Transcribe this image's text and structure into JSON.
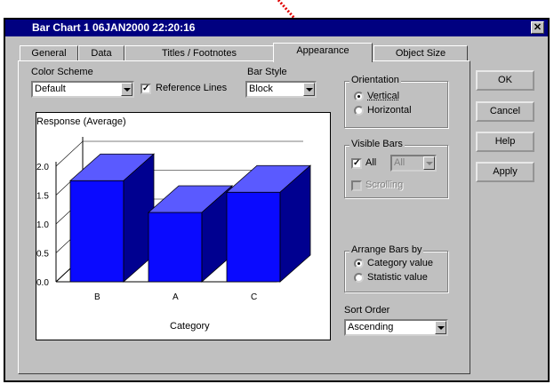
{
  "window": {
    "title": "Bar Chart 1 06JAN2000 22:20:16",
    "close_glyph": "✕"
  },
  "tabs": [
    "General",
    "Data",
    "Titles / Footnotes",
    "Appearance",
    "Object Size"
  ],
  "active_tab": "Appearance",
  "color_scheme": {
    "label": "Color Scheme",
    "value": "Default"
  },
  "reference_lines": {
    "label": "Reference Lines",
    "checked": true
  },
  "bar_style": {
    "label": "Bar Style",
    "value": "Block"
  },
  "orientation": {
    "title": "Orientation",
    "options": [
      "Vertical",
      "Horizontal"
    ],
    "selected": "Vertical"
  },
  "visible_bars": {
    "title": "Visible Bars",
    "all_label": "All",
    "all_checked": true,
    "combo_value": "All",
    "scrolling_label": "Scrolling"
  },
  "arrange_bars": {
    "title": "Arrange Bars by",
    "options": [
      "Category value",
      "Statistic value"
    ],
    "selected": "Category value"
  },
  "sort_order": {
    "label": "Sort Order",
    "value": "Ascending"
  },
  "buttons": {
    "ok": "OK",
    "cancel": "Cancel",
    "help": "Help",
    "apply": "Apply"
  },
  "colors": {
    "bar_front": "#0a0aff",
    "bar_top": "#5a5aff",
    "bar_side": "#000090",
    "title_bar": "#000080",
    "dialog": "#c0c0c0"
  },
  "chart_data": {
    "type": "bar",
    "title": "Response (Average)",
    "xlabel": "Category",
    "ylabel": "",
    "categories": [
      "B",
      "A",
      "C"
    ],
    "values": [
      1.75,
      1.2,
      1.55
    ],
    "ylim": [
      0,
      2.0
    ],
    "yticks": [
      "0.0",
      "0.5",
      "1.0",
      "1.5",
      "2.0"
    ],
    "style": "3d-block"
  }
}
